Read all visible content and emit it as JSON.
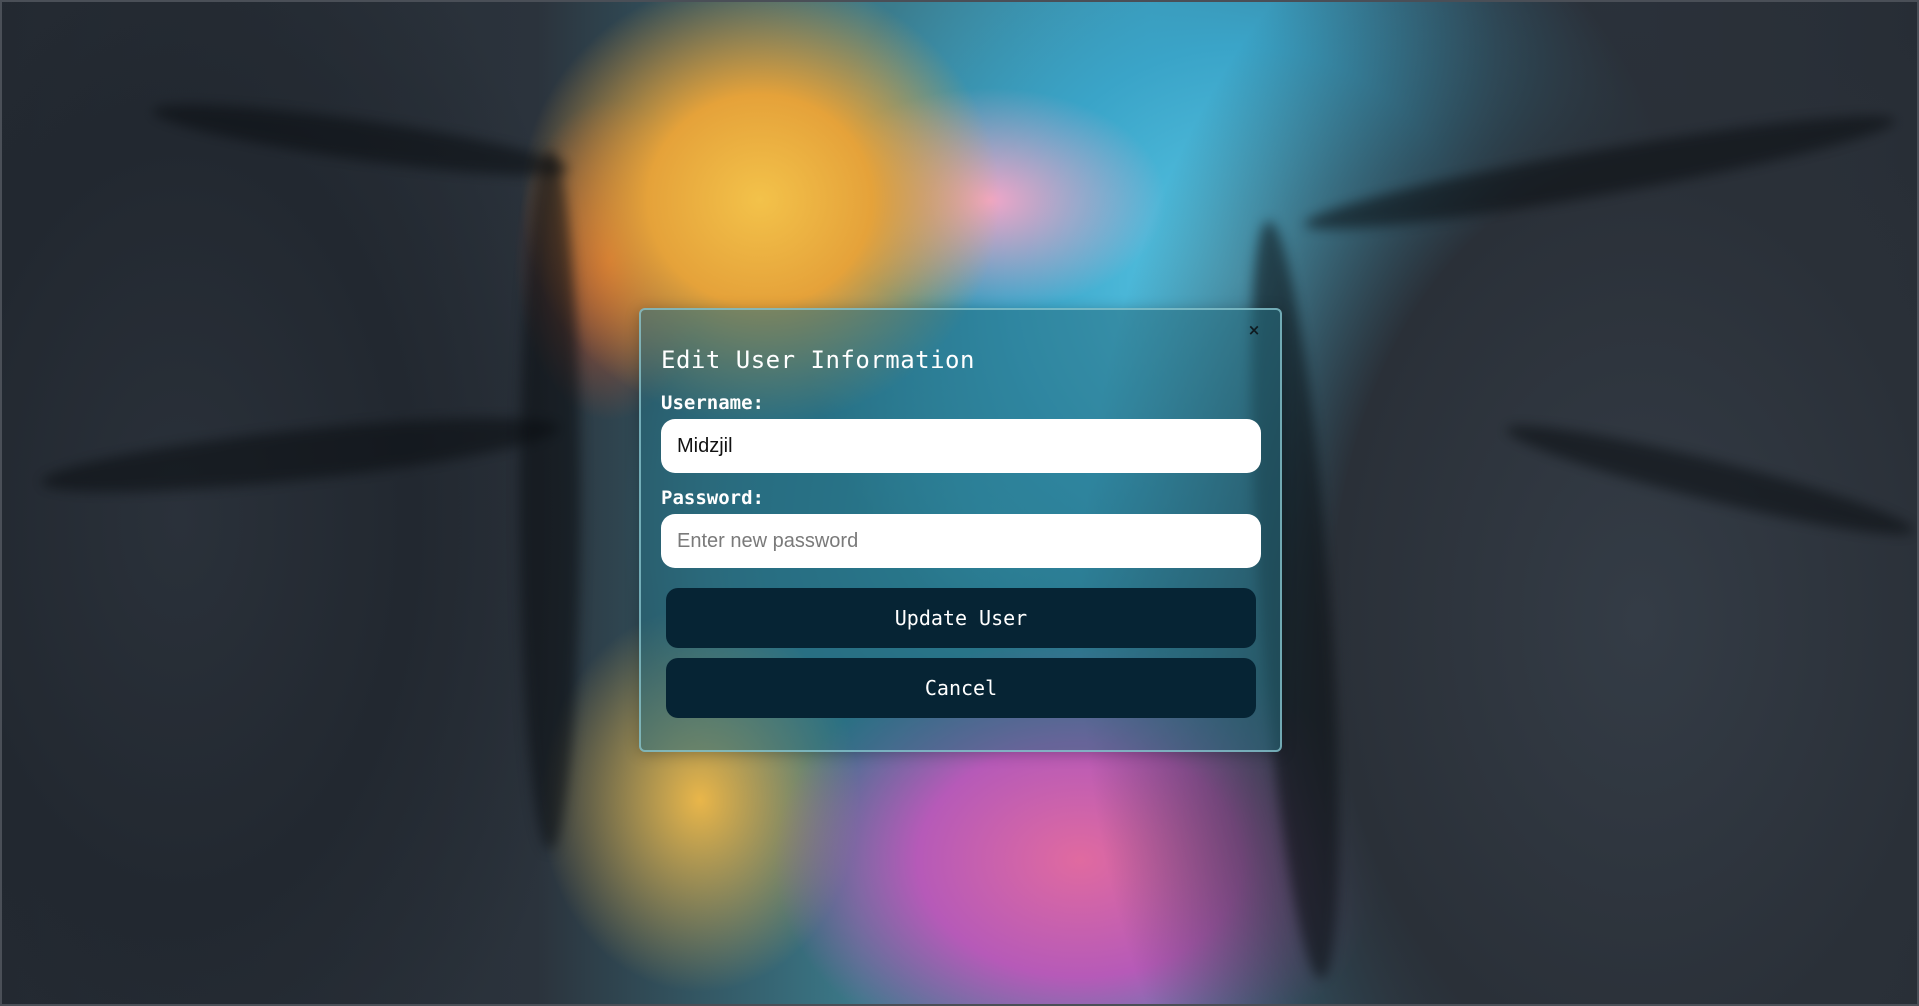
{
  "modal": {
    "title": "Edit User Information",
    "close_label": "×",
    "username_label": "Username:",
    "username_value": "Midzjil",
    "password_label": "Password:",
    "password_placeholder": "Enter new password",
    "password_value": "",
    "update_button": "Update User",
    "cancel_button": "Cancel"
  },
  "colors": {
    "modal_background": "#266e80",
    "button_background": "#062434",
    "button_text": "#ffffff",
    "input_background": "#ffffff"
  }
}
